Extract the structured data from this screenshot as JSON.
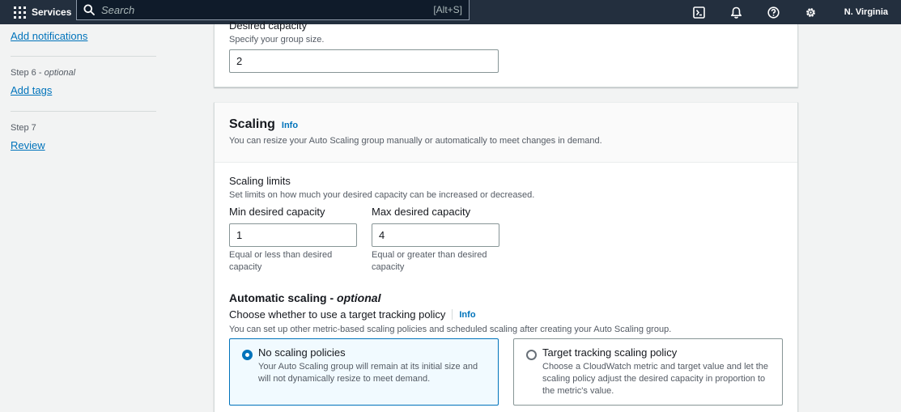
{
  "topnav": {
    "services_label": "Services",
    "search_placeholder": "Search",
    "search_shortcut": "[Alt+S]",
    "icons": [
      "cloudshell-icon",
      "notifications-bell-icon",
      "help-icon",
      "settings-gear-icon"
    ],
    "region": "N. Virginia"
  },
  "sidenav": {
    "add_notifications_link": "Add notifications",
    "step6_prefix": "Step 6 - ",
    "step6_optional": "optional",
    "add_tags_link": "Add tags",
    "step7_label": "Step 7",
    "review_link": "Review"
  },
  "desired_capacity": {
    "label": "Desired capacity",
    "description": "Specify your group size.",
    "value": "2"
  },
  "scaling": {
    "title": "Scaling",
    "info": "Info",
    "description": "You can resize your Auto Scaling group manually or automatically to meet changes in demand.",
    "limits": {
      "title": "Scaling limits",
      "description": "Set limits on how much your desired capacity can be increased or decreased.",
      "min_label": "Min desired capacity",
      "min_value": "1",
      "min_hint": "Equal or less than desired capacity",
      "max_label": "Max desired capacity",
      "max_value": "4",
      "max_hint": "Equal or greater than desired capacity"
    },
    "automatic": {
      "title": "Automatic scaling - ",
      "title_optional": "optional",
      "question": "Choose whether to use a target tracking policy",
      "info": "Info",
      "description": "You can set up other metric-based scaling policies and scheduled scaling after creating your Auto Scaling group.",
      "options": [
        {
          "title": "No scaling policies",
          "description": "Your Auto Scaling group will remain at its initial size and will not dynamically resize to meet demand.",
          "selected": true
        },
        {
          "title": "Target tracking scaling policy",
          "description": "Choose a CloudWatch metric and target value and let the scaling policy adjust the desired capacity in proportion to the metric's value.",
          "selected": false
        }
      ]
    }
  },
  "colors": {
    "nav_bg": "#232f3e",
    "link": "#0073bb",
    "selected_tile_bg": "#f1faff"
  }
}
